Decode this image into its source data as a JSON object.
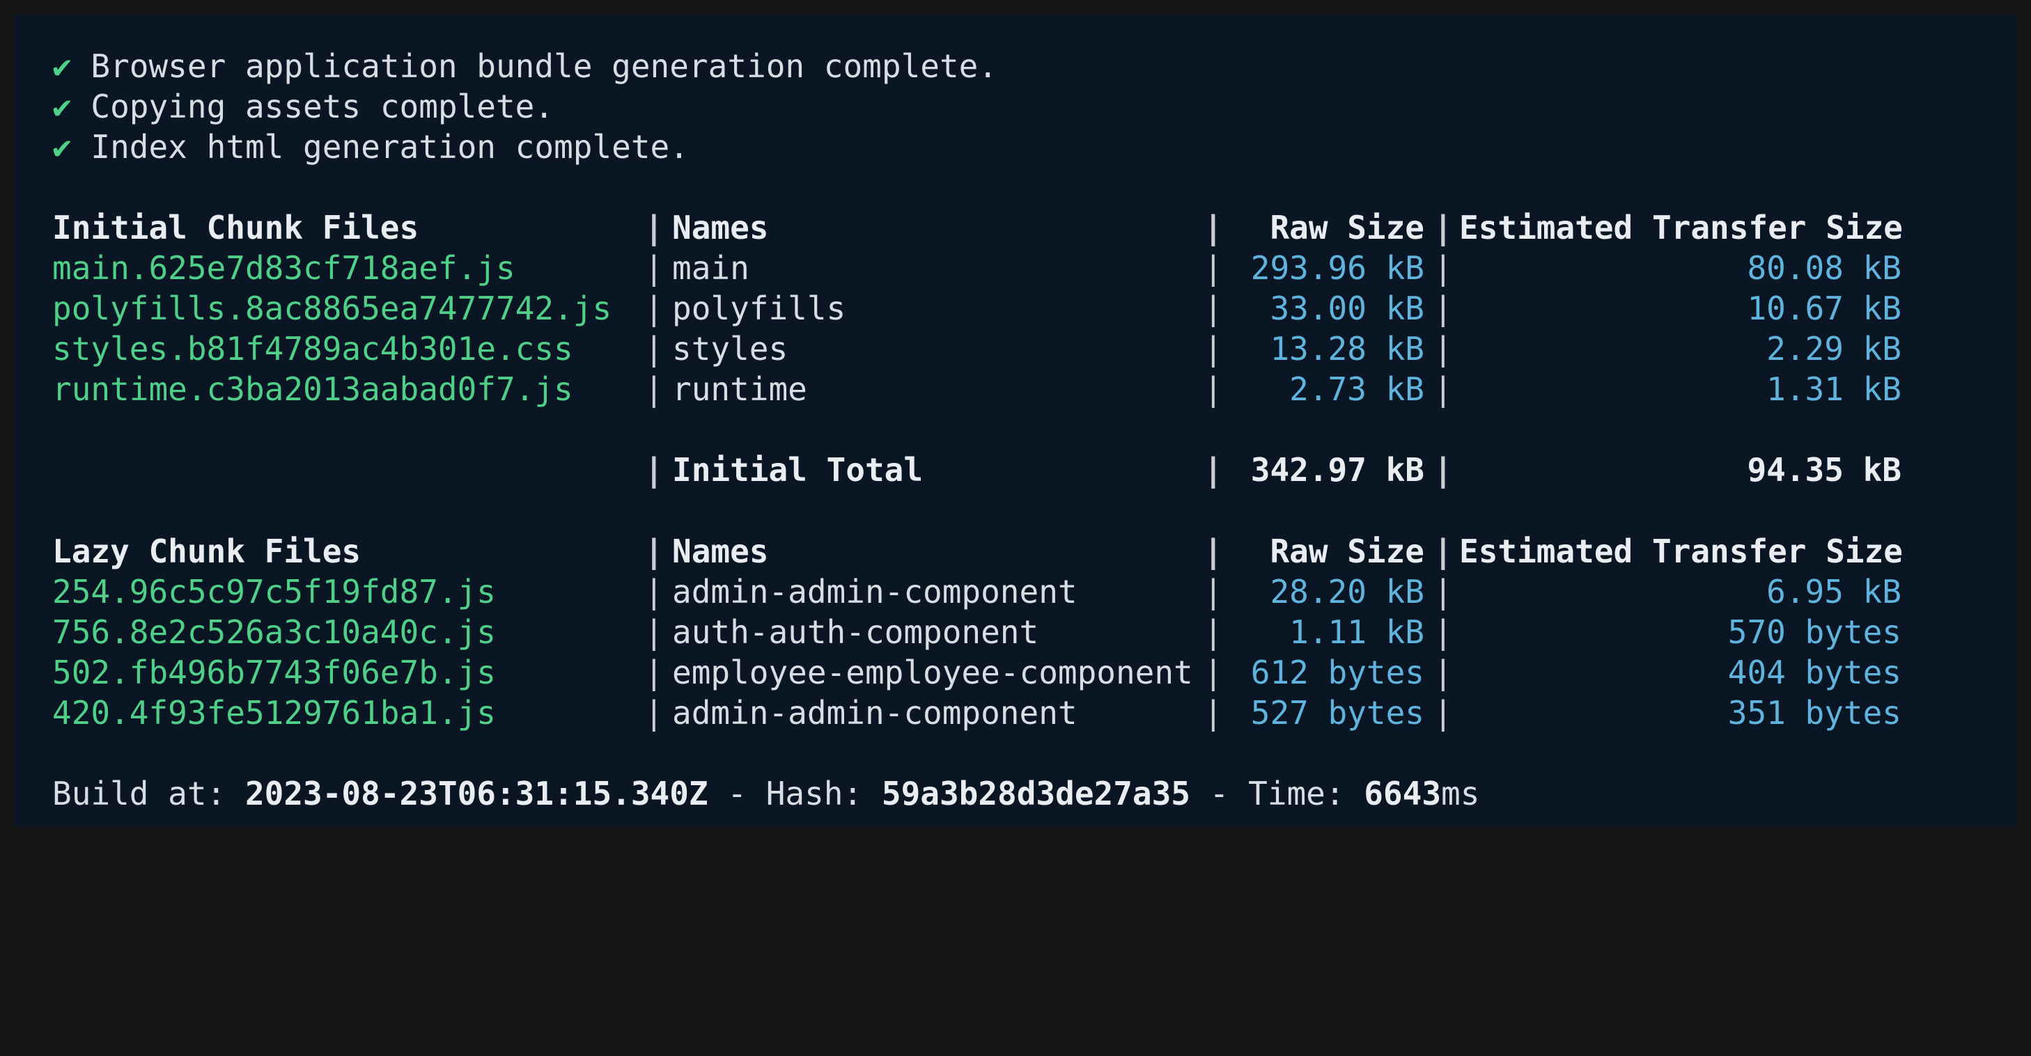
{
  "status_lines": [
    {
      "icon": "✔",
      "text": "Browser application bundle generation complete."
    },
    {
      "icon": "✔",
      "text": "Copying assets complete."
    },
    {
      "icon": "✔",
      "text": "Index html generation complete."
    }
  ],
  "separator": "|",
  "initial": {
    "headers": [
      "Initial Chunk Files",
      "Names",
      "Raw Size",
      "Estimated Transfer Size"
    ],
    "rows": [
      {
        "file": "main.625e7d83cf718aef.js",
        "name": "main",
        "raw": "293.96 kB",
        "transfer": "80.08 kB"
      },
      {
        "file": "polyfills.8ac8865ea7477742.js",
        "name": "polyfills",
        "raw": "33.00 kB",
        "transfer": "10.67 kB"
      },
      {
        "file": "styles.b81f4789ac4b301e.css",
        "name": "styles",
        "raw": "13.28 kB",
        "transfer": "2.29 kB"
      },
      {
        "file": "runtime.c3ba2013aabad0f7.js",
        "name": "runtime",
        "raw": "2.73 kB",
        "transfer": "1.31 kB"
      }
    ],
    "total": {
      "label": "Initial Total",
      "raw": "342.97 kB",
      "transfer": "94.35 kB"
    }
  },
  "lazy": {
    "headers": [
      "Lazy Chunk Files",
      "Names",
      "Raw Size",
      "Estimated Transfer Size"
    ],
    "rows": [
      {
        "file": "254.96c5c97c5f19fd87.js",
        "name": "admin-admin-component",
        "raw": "28.20 kB",
        "transfer": "6.95 kB"
      },
      {
        "file": "756.8e2c526a3c10a40c.js",
        "name": "auth-auth-component",
        "raw": "1.11 kB",
        "transfer": "570 bytes"
      },
      {
        "file": "502.fb496b7743f06e7b.js",
        "name": "employee-employee-component",
        "raw": "612 bytes",
        "transfer": "404 bytes"
      },
      {
        "file": "420.4f93fe5129761ba1.js",
        "name": "admin-admin-component",
        "raw": "527 bytes",
        "transfer": "351 bytes"
      }
    ]
  },
  "footer": {
    "build_label": "Build at: ",
    "build_time": "2023-08-23T06:31:15.340Z",
    "hash_label": " - Hash: ",
    "hash": "59a3b28d3de27a35",
    "time_label": " - Time: ",
    "time": "6643",
    "time_unit": "ms"
  },
  "colors": {
    "background": "#0a1624",
    "file": "#4fcf87",
    "size": "#5fb3dd",
    "text": "#d8dde3"
  }
}
